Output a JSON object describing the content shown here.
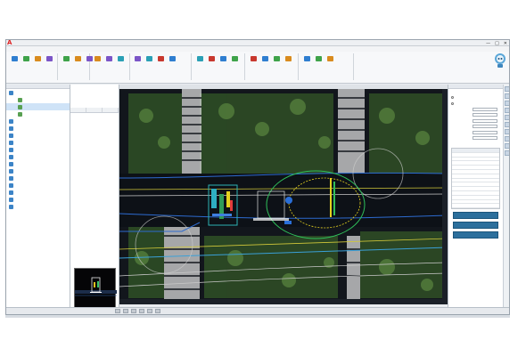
{
  "app": {
    "logo_letter": "A",
    "title": "",
    "window_buttons": [
      "—",
      "□",
      "✕"
    ]
  },
  "menubar": {
    "items": [
      "",
      "",
      "",
      "",
      "",
      "",
      "",
      "",
      "",
      "",
      "",
      "",
      "",
      ""
    ]
  },
  "ribbon": {
    "groups": [
      {
        "name": "",
        "buttons": [
          "",
          "",
          "",
          ""
        ]
      },
      {
        "name": "",
        "buttons": [
          "",
          "",
          ""
        ]
      },
      {
        "name": "",
        "buttons": [
          "",
          "",
          ""
        ]
      },
      {
        "name": "",
        "buttons": [
          "",
          "",
          "",
          ""
        ]
      },
      {
        "name": "",
        "buttons": [
          "",
          "",
          "",
          ""
        ]
      },
      {
        "name": "",
        "buttons": [
          "",
          "",
          "",
          ""
        ]
      },
      {
        "name": "",
        "buttons": [
          "",
          "",
          ""
        ]
      }
    ],
    "accent": "#2a7fc1"
  },
  "left_panel": {
    "header": "",
    "items": [
      {
        "label": "",
        "sub": false,
        "selected": false,
        "color": "#3c84c7"
      },
      {
        "label": "",
        "sub": true,
        "selected": false,
        "color": "#58a052"
      },
      {
        "label": "",
        "sub": true,
        "selected": true,
        "color": "#58a052"
      },
      {
        "label": "",
        "sub": true,
        "selected": false,
        "color": "#58a052"
      },
      {
        "label": "",
        "sub": false,
        "selected": false,
        "color": "#3c84c7"
      },
      {
        "label": "",
        "sub": false,
        "selected": false,
        "color": "#3c84c7"
      },
      {
        "label": "",
        "sub": false,
        "selected": false,
        "color": "#3c84c7"
      },
      {
        "label": "",
        "sub": false,
        "selected": false,
        "color": "#3c84c7"
      },
      {
        "label": "",
        "sub": false,
        "selected": false,
        "color": "#3c84c7"
      },
      {
        "label": "",
        "sub": false,
        "selected": false,
        "color": "#3c84c7"
      },
      {
        "label": "",
        "sub": false,
        "selected": false,
        "color": "#3c84c7"
      },
      {
        "label": "",
        "sub": false,
        "selected": false,
        "color": "#3c84c7"
      },
      {
        "label": "",
        "sub": false,
        "selected": false,
        "color": "#3c84c7"
      },
      {
        "label": "",
        "sub": false,
        "selected": false,
        "color": "#3c84c7"
      },
      {
        "label": "",
        "sub": false,
        "selected": false,
        "color": "#3c84c7"
      },
      {
        "label": "",
        "sub": false,
        "selected": false,
        "color": "#3c84c7"
      },
      {
        "label": "",
        "sub": false,
        "selected": false,
        "color": "#3c84c7"
      }
    ]
  },
  "mid_panel": {
    "top_rows": [
      [
        "",
        ""
      ],
      [
        "",
        ""
      ]
    ],
    "tabs": [
      "",
      "",
      ""
    ],
    "rows": [
      [
        "",
        ""
      ],
      [
        "",
        ""
      ],
      [
        "",
        ""
      ],
      [
        "",
        ""
      ],
      [
        "",
        ""
      ],
      [
        "",
        ""
      ],
      [
        "",
        ""
      ],
      [
        "",
        ""
      ],
      [
        "",
        ""
      ],
      [
        "",
        ""
      ],
      [
        "",
        ""
      ],
      [
        "",
        ""
      ]
    ]
  },
  "canvas": {
    "tabs": [
      "",
      ""
    ],
    "background": "#12161c"
  },
  "status": {
    "coords": ""
  },
  "right_panel": {
    "header": "",
    "rows": [
      {
        "kind": "label",
        "text": ""
      },
      {
        "kind": "radio",
        "text": ""
      },
      {
        "kind": "radio",
        "text": ""
      },
      {
        "kind": "field",
        "label": "",
        "value": ""
      },
      {
        "kind": "field",
        "label": "",
        "value": ""
      },
      {
        "kind": "field",
        "label": "",
        "value": ""
      },
      {
        "kind": "field",
        "label": "",
        "value": ""
      },
      {
        "kind": "field",
        "label": "",
        "value": ""
      },
      {
        "kind": "field",
        "label": "",
        "value": ""
      },
      {
        "kind": "label",
        "text": ""
      }
    ],
    "table_header": [
      "",
      "",
      ""
    ],
    "table_rows": [
      [
        "",
        "",
        ""
      ],
      [
        "",
        "",
        ""
      ],
      [
        "",
        "",
        ""
      ],
      [
        "",
        "",
        ""
      ],
      [
        "",
        "",
        ""
      ],
      [
        "",
        "",
        ""
      ],
      [
        "",
        "",
        ""
      ],
      [
        "",
        "",
        ""
      ],
      [
        "",
        "",
        ""
      ],
      [
        "",
        "",
        ""
      ],
      [
        "",
        "",
        ""
      ],
      [
        "",
        "",
        ""
      ],
      [
        "",
        "",
        ""
      ]
    ],
    "buttons": [
      "",
      "",
      ""
    ],
    "button_color": "#2c6f9c"
  }
}
